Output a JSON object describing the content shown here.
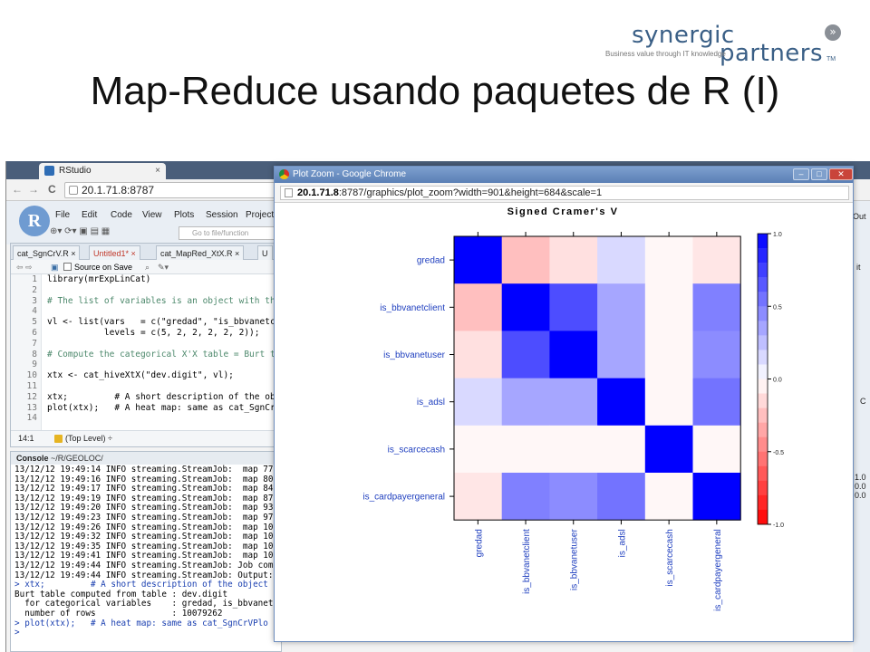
{
  "slide": {
    "title": "Map-Reduce usando paquetes de R (I)",
    "logo": {
      "top": "synergic",
      "bottom": "partners",
      "tagline": "Business value through IT knowledge",
      "tm": "TM",
      "chevron": "»"
    }
  },
  "rstudio": {
    "tab_title": "RStudio",
    "tab_close": "×",
    "nav": {
      "back": "←",
      "forward": "→",
      "reload": "C"
    },
    "url": "20.1.71.8:8787",
    "menu": [
      "File",
      "Edit",
      "Code",
      "View",
      "Plots",
      "Session",
      "Project"
    ],
    "logo": "R",
    "goto_placeholder": "Go to file/function",
    "editor": {
      "tabs": [
        "cat_SgnCrV.R ×",
        "Untitled1* ×",
        "cat_MapRed_XtX.R ×",
        "U"
      ],
      "source_on_save": "Source on Save",
      "line_numbers": [
        "1",
        "2",
        "3",
        "4",
        "5",
        "6",
        "7",
        "8",
        "9",
        "10",
        "11",
        "12",
        "13",
        "14"
      ],
      "lines": [
        "library(mrExpLinCat)",
        "",
        "# The list of variables is an object with the",
        "",
        "vl <- list(vars   = c(\"gredad\", \"is_bbvanetcl",
        "           levels = c(5, 2, 2, 2, 2, 2));",
        "",
        "# Compute the categorical X'X table = Burt ta",
        "",
        "xtx <- cat_hiveXtX(\"dev.digit\", vl);",
        "",
        "xtx;         # A short description of the ob",
        "plot(xtx);   # A heat map: same as cat_SgnCr",
        ""
      ],
      "status_pos": "14:1",
      "status_scope": "(Top Level) ÷"
    },
    "console": {
      "label": "Console",
      "path": "~/R/GEOLOC/",
      "lines": [
        "13/12/12 19:49:14 INFO streaming.StreamJob:  map 77",
        "13/12/12 19:49:16 INFO streaming.StreamJob:  map 80",
        "13/12/12 19:49:17 INFO streaming.StreamJob:  map 84",
        "13/12/12 19:49:19 INFO streaming.StreamJob:  map 87",
        "13/12/12 19:49:20 INFO streaming.StreamJob:  map 93",
        "13/12/12 19:49:23 INFO streaming.StreamJob:  map 97",
        "13/12/12 19:49:26 INFO streaming.StreamJob:  map 10",
        "13/12/12 19:49:32 INFO streaming.StreamJob:  map 10",
        "13/12/12 19:49:35 INFO streaming.StreamJob:  map 10",
        "13/12/12 19:49:41 INFO streaming.StreamJob:  map 10",
        "13/12/12 19:49:44 INFO streaming.StreamJob: Job com",
        "13/12/12 19:49:44 INFO streaming.StreamJob: Output:",
        "> xtx;         # A short description of the object",
        "Burt table computed from table : dev.digit",
        "  for categorical variables    : gredad, is_bbvanet",
        "  number of rows               : 10079262",
        "> plot(xtx);   # A heat map: same as cat_SgnCrVPlo",
        ">"
      ]
    },
    "right_panel": [
      "Out",
      "it",
      "C",
      "1.0",
      "0.0",
      "0.0"
    ]
  },
  "popup": {
    "title": "Plot Zoom - Google Chrome",
    "buttons": {
      "min": "–",
      "max": "□",
      "close": "✕"
    },
    "url_host": "20.1.71.8",
    "url_rest": ":8787/graphics/plot_zoom?width=901&height=684&scale=1"
  },
  "chart_data": {
    "type": "heatmap",
    "title": "Signed Cramer's V",
    "rows": [
      "gredad",
      "is_bbvanetclient",
      "is_bbvanetuser",
      "is_adsl",
      "is_scarcecash",
      "is_cardpayergeneral"
    ],
    "cols": [
      "gredad",
      "is_bbvanetclient",
      "is_bbvanetuser",
      "is_adsl",
      "is_scarcecash",
      "is_cardpayergeneral"
    ],
    "values": [
      [
        1.0,
        -0.25,
        -0.12,
        0.15,
        -0.03,
        -0.1
      ],
      [
        -0.25,
        1.0,
        0.7,
        0.35,
        -0.03,
        0.5
      ],
      [
        -0.12,
        0.7,
        1.0,
        0.35,
        -0.03,
        0.45
      ],
      [
        0.15,
        0.35,
        0.35,
        1.0,
        -0.03,
        0.55
      ],
      [
        -0.03,
        -0.03,
        -0.03,
        -0.03,
        1.0,
        -0.03
      ],
      [
        -0.1,
        0.5,
        0.45,
        0.55,
        -0.03,
        1.0
      ]
    ],
    "scale": {
      "min": -1.0,
      "max": 1.0,
      "ticks": [
        "1.0",
        "0.5",
        "0.0",
        "-0.5",
        "-1.0"
      ]
    },
    "colors": {
      "positive": "#0000ff",
      "negative": "#ff0000",
      "neutral": "#ffffff",
      "label": "#1f3fbf"
    }
  }
}
